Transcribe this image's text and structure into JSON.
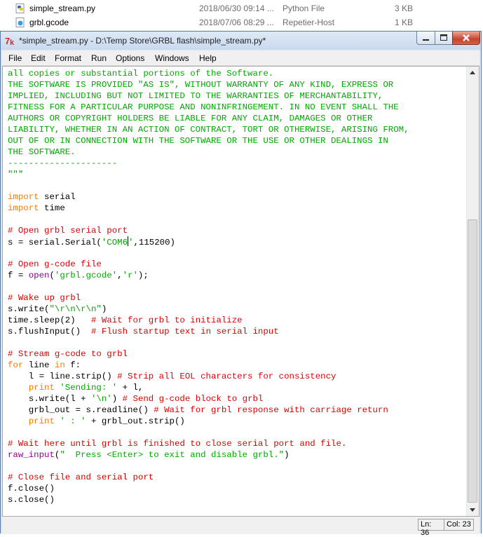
{
  "explorer": {
    "files": [
      {
        "name": "simple_stream.py",
        "date": "2018/06/30 09:14 ...",
        "type": "Python File",
        "size": "3 KB"
      },
      {
        "name": "grbl.gcode",
        "date": "2018/07/06 08:29 ...",
        "type": "Repetier-Host",
        "size": "1 KB"
      }
    ]
  },
  "window": {
    "title": "*simple_stream.py - D:\\Temp Store\\GRBL flash\\simple_stream.py*"
  },
  "menu": [
    "File",
    "Edit",
    "Format",
    "Run",
    "Options",
    "Windows",
    "Help"
  ],
  "editor": {
    "lines": [
      [
        [
          "all copies or substantial portions of the Software.",
          "str"
        ]
      ],
      [
        [
          "THE SOFTWARE IS PROVIDED \"AS IS\", WITHOUT WARRANTY OF ANY KIND, EXPRESS OR",
          "str"
        ]
      ],
      [
        [
          "IMPLIED, INCLUDING BUT NOT LIMITED TO THE WARRANTIES OF MERCHANTABILITY,",
          "str"
        ]
      ],
      [
        [
          "FITNESS FOR A PARTICULAR PURPOSE AND NONINFRINGEMENT. IN NO EVENT SHALL THE",
          "str"
        ]
      ],
      [
        [
          "AUTHORS OR COPYRIGHT HOLDERS BE LIABLE FOR ANY CLAIM, DAMAGES OR OTHER",
          "str"
        ]
      ],
      [
        [
          "LIABILITY, WHETHER IN AN ACTION OF CONTRACT, TORT OR OTHERWISE, ARISING FROM,",
          "str"
        ]
      ],
      [
        [
          "OUT OF OR IN CONNECTION WITH THE SOFTWARE OR THE USE OR OTHER DEALINGS IN",
          "str"
        ]
      ],
      [
        [
          "THE SOFTWARE.",
          "str"
        ]
      ],
      [
        [
          "---------------------",
          "str"
        ]
      ],
      [
        [
          "\"\"\"",
          "str"
        ]
      ],
      [],
      [
        [
          "import",
          "kw"
        ],
        [
          " serial",
          ""
        ]
      ],
      [
        [
          "import",
          "kw"
        ],
        [
          " time",
          ""
        ]
      ],
      [],
      [
        [
          "# Open grbl serial port",
          "cm"
        ]
      ],
      [
        [
          "s = serial.Serial(",
          ""
        ],
        [
          "'COM6",
          "str"
        ],
        [
          "CURSOR",
          ""
        ],
        [
          "'",
          "str"
        ],
        [
          ",115200)",
          ""
        ]
      ],
      [],
      [
        [
          "# Open g-code file",
          "cm"
        ]
      ],
      [
        [
          "f = ",
          ""
        ],
        [
          "open",
          "bi"
        ],
        [
          "(",
          ""
        ],
        [
          "'grbl.gcode'",
          "str"
        ],
        [
          ",",
          ""
        ],
        [
          "'r'",
          "str"
        ],
        [
          ");",
          ""
        ]
      ],
      [],
      [
        [
          "# Wake up grbl",
          "cm"
        ]
      ],
      [
        [
          "s.write(",
          ""
        ],
        [
          "\"\\r\\n\\r\\n\"",
          "str"
        ],
        [
          ")",
          ""
        ]
      ],
      [
        [
          "time.sleep(2)   ",
          ""
        ],
        [
          "# Wait for grbl to initialize",
          "cm"
        ]
      ],
      [
        [
          "s.flushInput()  ",
          ""
        ],
        [
          "# Flush startup text in serial input",
          "cm"
        ]
      ],
      [],
      [
        [
          "# Stream g-code to grbl",
          "cm"
        ]
      ],
      [
        [
          "for",
          "kw"
        ],
        [
          " line ",
          ""
        ],
        [
          "in",
          "kw"
        ],
        [
          " f:",
          ""
        ]
      ],
      [
        [
          "    l = line.strip() ",
          ""
        ],
        [
          "# Strip all EOL characters for consistency",
          "cm"
        ]
      ],
      [
        [
          "    ",
          ""
        ],
        [
          "print",
          "kw"
        ],
        [
          " ",
          ""
        ],
        [
          "'Sending: '",
          "str"
        ],
        [
          " + l,",
          ""
        ]
      ],
      [
        [
          "    s.write(l + ",
          ""
        ],
        [
          "'\\n'",
          "str"
        ],
        [
          ") ",
          ""
        ],
        [
          "# Send g-code block to grbl",
          "cm"
        ]
      ],
      [
        [
          "    grbl_out = s.readline() ",
          ""
        ],
        [
          "# Wait for grbl response with carriage return",
          "cm"
        ]
      ],
      [
        [
          "    ",
          ""
        ],
        [
          "print",
          "kw"
        ],
        [
          " ",
          ""
        ],
        [
          "' : '",
          "str"
        ],
        [
          " + grbl_out.strip()",
          ""
        ]
      ],
      [],
      [
        [
          "# Wait here until grbl is finished to close serial port and file.",
          "cm"
        ]
      ],
      [
        [
          "raw_input",
          "bi"
        ],
        [
          "(",
          ""
        ],
        [
          "\"  Press <Enter> to exit and disable grbl.\"",
          "str"
        ],
        [
          ")",
          ""
        ]
      ],
      [],
      [
        [
          "# Close file and serial port",
          "cm"
        ]
      ],
      [
        [
          "f.close()",
          ""
        ]
      ],
      [
        [
          "s.close()",
          ""
        ]
      ]
    ]
  },
  "status": {
    "line": "Ln: 36",
    "col": "Col: 23"
  },
  "colors": {
    "string": "#00aa00",
    "keyword": "#ff7700",
    "comment": "#dd0000",
    "builtin": "#900090"
  },
  "icons": {
    "app": "python-idle-icon",
    "file": "python-file-icon"
  }
}
